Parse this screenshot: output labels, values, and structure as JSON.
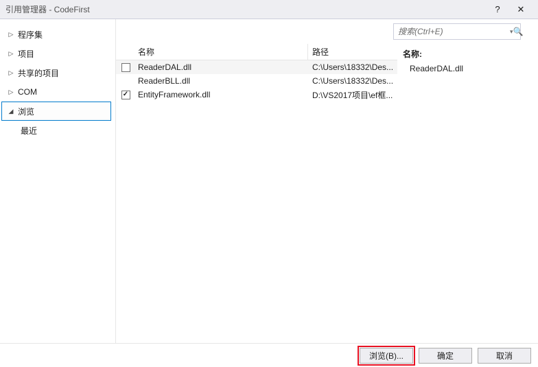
{
  "title": "引用管理器 - CodeFirst",
  "titlebar": {
    "help": "?",
    "close": "✕"
  },
  "sidebar": {
    "items": [
      {
        "label": "程序集",
        "expandable": true
      },
      {
        "label": "项目",
        "expandable": true
      },
      {
        "label": "共享的项目",
        "expandable": true
      },
      {
        "label": "COM",
        "expandable": true
      },
      {
        "label": "浏览",
        "expandable": true,
        "selected": true
      },
      {
        "label": "最近",
        "sub": true
      }
    ]
  },
  "search": {
    "placeholder": "搜索(Ctrl+E)"
  },
  "columns": {
    "name": "名称",
    "path": "路径"
  },
  "rows": [
    {
      "checked": false,
      "selected": true,
      "name": "ReaderDAL.dll",
      "path": "C:\\Users\\18332\\Des..."
    },
    {
      "checked": null,
      "selected": false,
      "name": "ReaderBLL.dll",
      "path": "C:\\Users\\18332\\Des..."
    },
    {
      "checked": true,
      "selected": false,
      "name": "EntityFramework.dll",
      "path": "D:\\VS2017项目\\ef框..."
    }
  ],
  "details": {
    "name_label": "名称:",
    "name_value": "ReaderDAL.dll"
  },
  "footer": {
    "browse": "浏览(B)...",
    "ok": "确定",
    "cancel": "取消"
  }
}
